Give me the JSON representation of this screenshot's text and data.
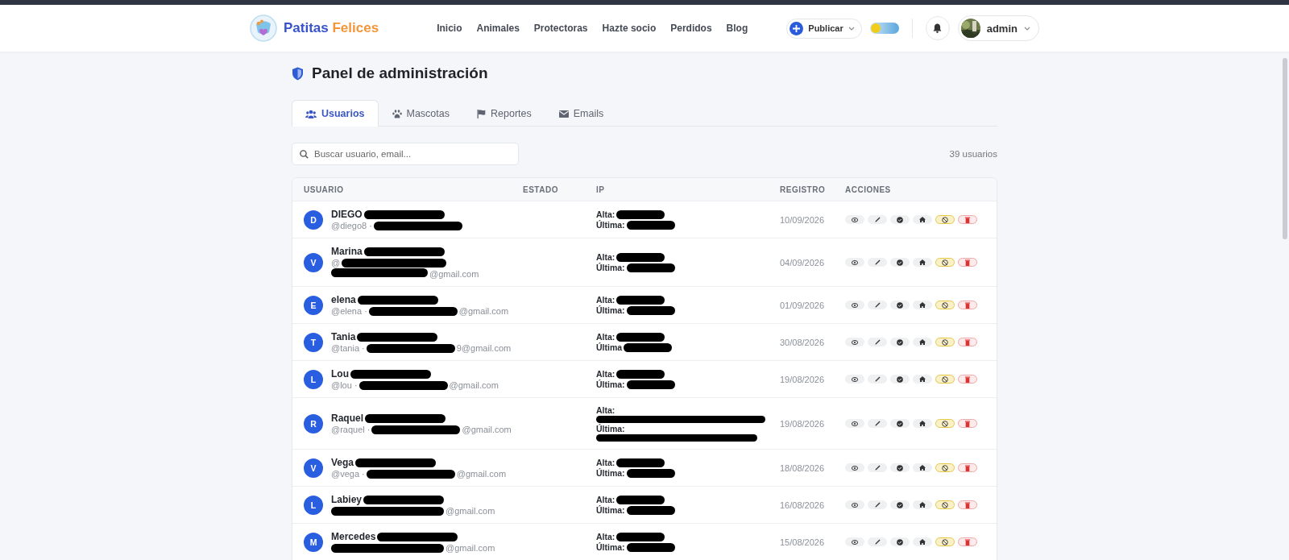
{
  "header": {
    "brand": {
      "first": "Patitas",
      "second": "Felices"
    },
    "nav": [
      {
        "label": "Inicio"
      },
      {
        "label": "Animales"
      },
      {
        "label": "Protectoras"
      },
      {
        "label": "Hazte socio"
      },
      {
        "label": "Perdidos"
      },
      {
        "label": "Blog"
      }
    ],
    "publish_button": "Publicar",
    "theme_toggle": {
      "dark": false
    },
    "user": "admin"
  },
  "title": "Panel de administración",
  "tabs": [
    {
      "label": "Usuarios",
      "selected": true
    },
    {
      "label": "Mascotas",
      "selected": false
    },
    {
      "label": "Reportes",
      "selected": false
    },
    {
      "label": "Emails",
      "selected": false
    }
  ],
  "search": {
    "placeholder": "Buscar usuario, email..."
  },
  "count": "39 usuarios",
  "table": {
    "columns": [
      "USUARIO",
      "ESTADO",
      "IP",
      "REGISTRO",
      "ACCIONES"
    ],
    "rows": [
      {
        "initial": "D",
        "name": "DIEGO",
        "handle": "@diego8 ·",
        "kind": "inline",
        "redacted": true,
        "ip": {
          "kind": "inline",
          "alta": "Alta:",
          "ultima": "Última:"
        },
        "date": "10/09/2026"
      },
      {
        "initial": "V",
        "name": "Marina",
        "handle": "@",
        "email": "@gmail.com",
        "kind": "stacked",
        "redacted": true,
        "ip": {
          "kind": "inline",
          "alta": "Alta:",
          "ultima": "Última:"
        },
        "date": "04/09/2026"
      },
      {
        "initial": "E",
        "name": "elena",
        "handle": "@elena ·",
        "email": "@gmail.com",
        "kind": "inline",
        "redacted": true,
        "ip": {
          "kind": "inline",
          "alta": "Alta:",
          "ultima": "Última:"
        },
        "date": "01/09/2026"
      },
      {
        "initial": "T",
        "name": "Tania",
        "handle": "@tania ·",
        "email": "9@gmail.com",
        "kind": "inline",
        "redacted": true,
        "ip": {
          "kind": "inline",
          "alta": "Alta:",
          "ultima": "Última"
        },
        "date": "30/08/2026"
      },
      {
        "initial": "L",
        "name": "Lou",
        "handle": "@lou ·",
        "email": "@gmail.com",
        "kind": "inline",
        "redacted": true,
        "ip": {
          "kind": "inline",
          "alta": "Alta:",
          "ultima": "Última:"
        },
        "date": "19/08/2026"
      },
      {
        "initial": "R",
        "name": "Raquel",
        "handle": "@raquel ·",
        "email": "@gmail.com",
        "kind": "inline",
        "redacted": true,
        "ip": {
          "kind": "wide",
          "alta": "Alta:",
          "ultima": "Última:"
        },
        "date": "19/08/2026"
      },
      {
        "initial": "V",
        "name": "Vega",
        "handle": "@vega ·",
        "email": "@gmail.com",
        "kind": "inline",
        "redacted": true,
        "ip": {
          "kind": "inline",
          "alta": "Alta:",
          "ultima": "Última:"
        },
        "date": "18/08/2026"
      },
      {
        "initial": "L",
        "name": "Labiey",
        "email": "@gmail.com",
        "kind": "inline",
        "redacted": true,
        "ip": {
          "kind": "inline",
          "alta": "Alta:",
          "ultima": "Última:"
        },
        "date": "16/08/2026"
      },
      {
        "initial": "M",
        "name": "Mercedes",
        "email": "@gmail.com",
        "kind": "inline",
        "redacted": true,
        "ip": {
          "kind": "inline",
          "alta": "Alta:",
          "ultima": "Última:"
        },
        "date": "15/08/2026"
      }
    ]
  }
}
